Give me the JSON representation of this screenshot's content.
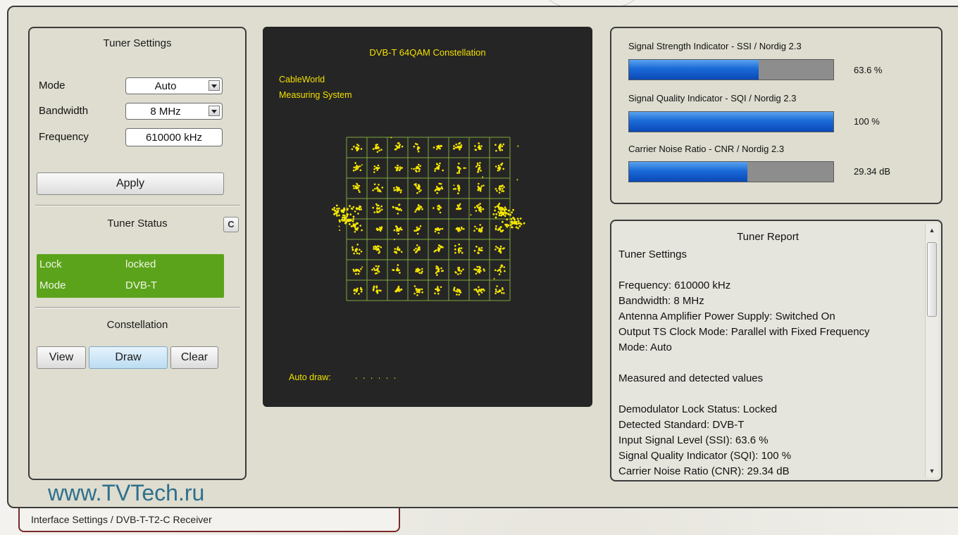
{
  "tuner_settings": {
    "title": "Tuner Settings",
    "mode_label": "Mode",
    "mode_value": "Auto",
    "bandwidth_label": "Bandwidth",
    "bandwidth_value": "8 MHz",
    "frequency_label": "Frequency",
    "frequency_value": "610000 kHz",
    "apply_label": "Apply"
  },
  "tuner_status": {
    "title": "Tuner Status",
    "refresh_icon": "C",
    "lock_label": "Lock",
    "lock_value": "locked",
    "mode_label": "Mode",
    "mode_value": "DVB-T",
    "status_color": "#5ba31a"
  },
  "constellation_controls": {
    "title": "Constellation",
    "view_label": "View",
    "draw_label": "Draw",
    "clear_label": "Clear"
  },
  "constellation_view": {
    "title": "DVB-T 64QAM Constellation",
    "brand_line1": "CableWorld",
    "brand_line2": "Measuring System",
    "auto_draw_label": "Auto draw:",
    "auto_draw_dots": ". . . . . .",
    "qam_order": 64,
    "grid_size": 8,
    "point_color": "#f5e600",
    "grid_color": "#7fa83a",
    "background": "#252525"
  },
  "signal": {
    "ssi_label": "Signal Strength Indicator - SSI / Nordig 2.3",
    "ssi_value": "63.6 %",
    "ssi_fraction": 0.636,
    "sqi_label": "Signal Quality Indicator - SQI / Nordig 2.3",
    "sqi_value": "100 %",
    "sqi_fraction": 1.0,
    "cnr_label": "Carrier Noise Ratio - CNR / Nordig 2.3",
    "cnr_value": "29.34 dB",
    "cnr_fraction": 0.58
  },
  "report": {
    "title": "Tuner Report",
    "lines": [
      "Tuner Settings",
      "",
      "Frequency: 610000 kHz",
      "Bandwidth: 8 MHz",
      "Antenna Amplifier Power Supply: Switched On",
      "Output TS Clock Mode: Parallel with Fixed Frequency",
      "Mode: Auto",
      "",
      "Measured and detected values",
      "",
      "Demodulator Lock Status: Locked",
      "Detected Standard: DVB-T",
      "Input Signal Level (SSI): 63.6 %",
      "Signal Quality Indicator (SQI): 100 %",
      "Carrier Noise Ratio (CNR): 29.34 dB"
    ]
  },
  "watermark": "www.TVTech.ru",
  "bottom_tab": "Interface Settings / DVB-T-T2-C Receiver"
}
